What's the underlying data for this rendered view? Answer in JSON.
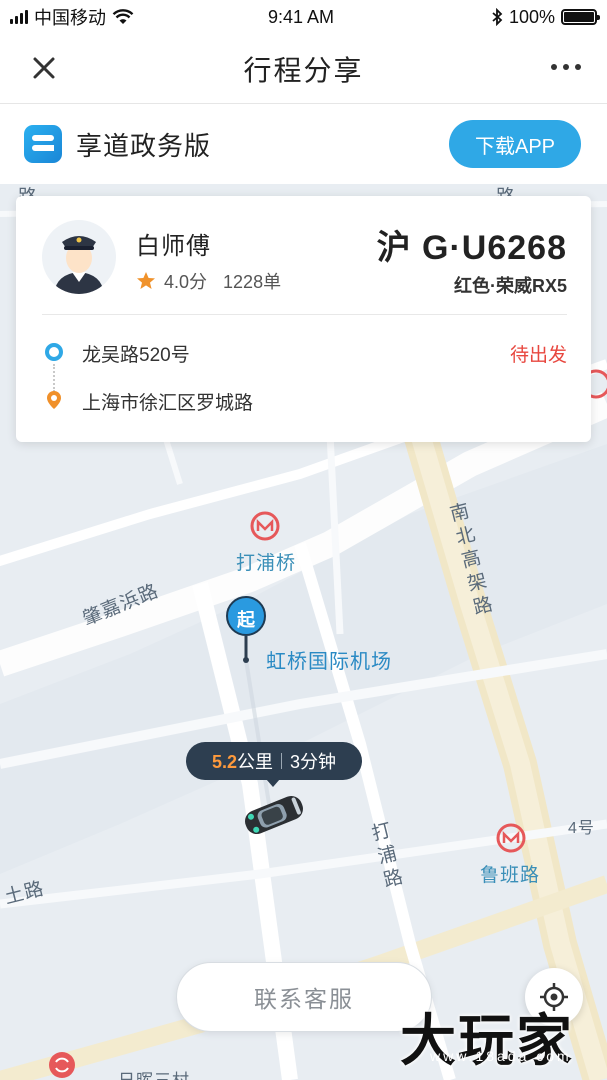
{
  "status_bar": {
    "carrier": "中国移动",
    "time": "9:41 AM",
    "battery": "100%",
    "battery_level": 1.0
  },
  "nav": {
    "title": "行程分享",
    "close_icon": "close-icon",
    "more_icon": "more-icon"
  },
  "app_banner": {
    "name": "享道政务版",
    "download_label": "下载APP"
  },
  "driver": {
    "name": "白师傅",
    "rating": "4.0分",
    "orders": "1228单",
    "plate": "沪 G·U6268",
    "car": "红色·荣威RX5"
  },
  "route": {
    "from": "龙吴路520号",
    "to": "上海市徐汇区罗城路",
    "status": "待出发"
  },
  "map": {
    "labels": {
      "daopu": "打浦桥",
      "zhaojiabang": "肇嘉浜路",
      "nanbei": "南北高架路",
      "dapu_road": "打浦路",
      "luban": "鲁班路",
      "tu_road": "土路",
      "line4": "4号",
      "airport": "虹桥国际机场",
      "bottom_road": "日晖三村",
      "top_road": "路",
      "top_road2": "路"
    },
    "start_marker": "起",
    "trip_distance": "5.2",
    "distance_unit": "公里",
    "trip_time": "3分钟"
  },
  "contact_label": "联系客服",
  "watermark": "大玩家",
  "watermark_sub": "www.18ada.com",
  "colors": {
    "accent": "#2fa8e6",
    "status": "#e8473f",
    "route_from": "#2fa8e6",
    "route_to": "#f0902a"
  }
}
